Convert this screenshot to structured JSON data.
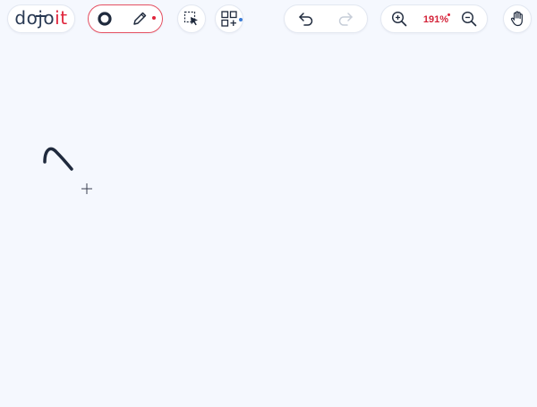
{
  "logo": {
    "part1": "dojo",
    "part2": "it"
  },
  "toolbar": {
    "stroke_width_icon": "ring-icon",
    "pen_icon": "pencil-icon",
    "select_icon": "selection-cursor-icon",
    "shapes_icon": "shapes-grid-icon",
    "undo_icon": "undo-icon",
    "redo_icon": "redo-icon",
    "zoom_in_icon": "zoom-in-icon",
    "zoom_out_icon": "zoom-out-icon",
    "hand_icon": "hand-icon"
  },
  "zoom": {
    "level": "191%"
  },
  "colors": {
    "background": "#f5f8fe",
    "accent": "#e0243b",
    "ink": "#1f2a3d",
    "info_dot": "#3a7bd5"
  }
}
